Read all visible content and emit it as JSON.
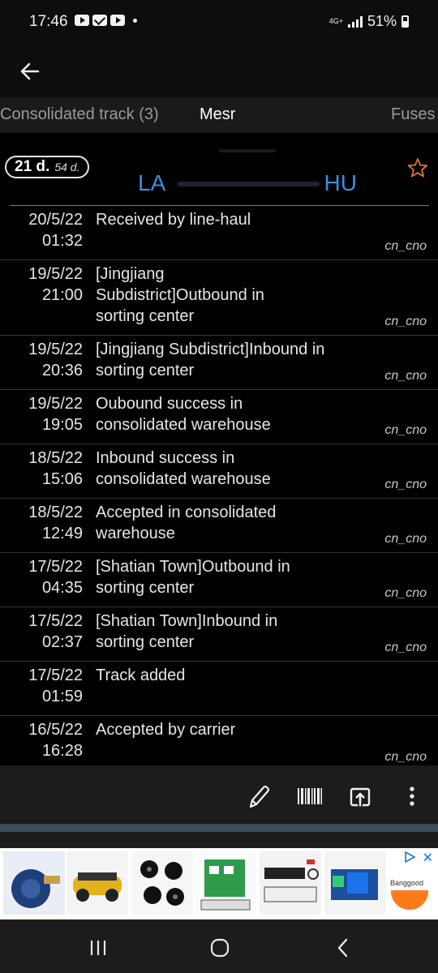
{
  "status_bar": {
    "time": "17:46",
    "network": "4G+",
    "battery": "51%",
    "battery_level": 0.51,
    "left_icons": [
      "youtube-icon",
      "mail-icon",
      "youtube-icon"
    ]
  },
  "tabs": [
    {
      "label": "Consolidated track (3)"
    },
    {
      "label": "Mesr"
    },
    {
      "label": "Fuses"
    }
  ],
  "header": {
    "days_main": "21 d.",
    "days_sub": "54 d.",
    "route_from": "LA",
    "route_to": "HU"
  },
  "events": [
    {
      "date": "20/5/22",
      "time": "01:32",
      "desc": "Received by line-haul",
      "source": "cn_cno"
    },
    {
      "date": "19/5/22",
      "time": "21:00",
      "desc": "[Jingjiang Subdistrict]Outbound in sorting center",
      "source": "cn_cno"
    },
    {
      "date": "19/5/22",
      "time": "20:36",
      "desc": "[Jingjiang Subdistrict]Inbound in sorting center",
      "source": "cn_cno"
    },
    {
      "date": "19/5/22",
      "time": "19:05",
      "desc": "Oubound success in consolidated warehouse",
      "source": "cn_cno"
    },
    {
      "date": "18/5/22",
      "time": "15:06",
      "desc": "Inbound success in consolidated warehouse",
      "source": "cn_cno"
    },
    {
      "date": "18/5/22",
      "time": "12:49",
      "desc": "Accepted in consolidated warehouse",
      "source": "cn_cno"
    },
    {
      "date": "17/5/22",
      "time": "04:35",
      "desc": "[Shatian Town]Outbound in sorting center",
      "source": "cn_cno"
    },
    {
      "date": "17/5/22",
      "time": "02:37",
      "desc": "[Shatian Town]Inbound in sorting center",
      "source": "cn_cno"
    },
    {
      "date": "17/5/22",
      "time": "01:59",
      "desc": "Track added",
      "source": ""
    },
    {
      "date": "16/5/22",
      "time": "16:28",
      "desc": "Accepted by carrier",
      "source": "cn_cno"
    }
  ],
  "toolbar": {
    "icons": [
      "pencil-icon",
      "barcode-icon",
      "share-icon",
      "more-vertical-icon"
    ]
  },
  "ad": {
    "brand": "Banggood",
    "colors": {
      "accent": "#ff7a1a",
      "link": "#1a73e8"
    }
  },
  "colors": {
    "route": "#3d8fe0",
    "star": "#e0742b",
    "divider": "#a5714b",
    "background": "#000000"
  }
}
